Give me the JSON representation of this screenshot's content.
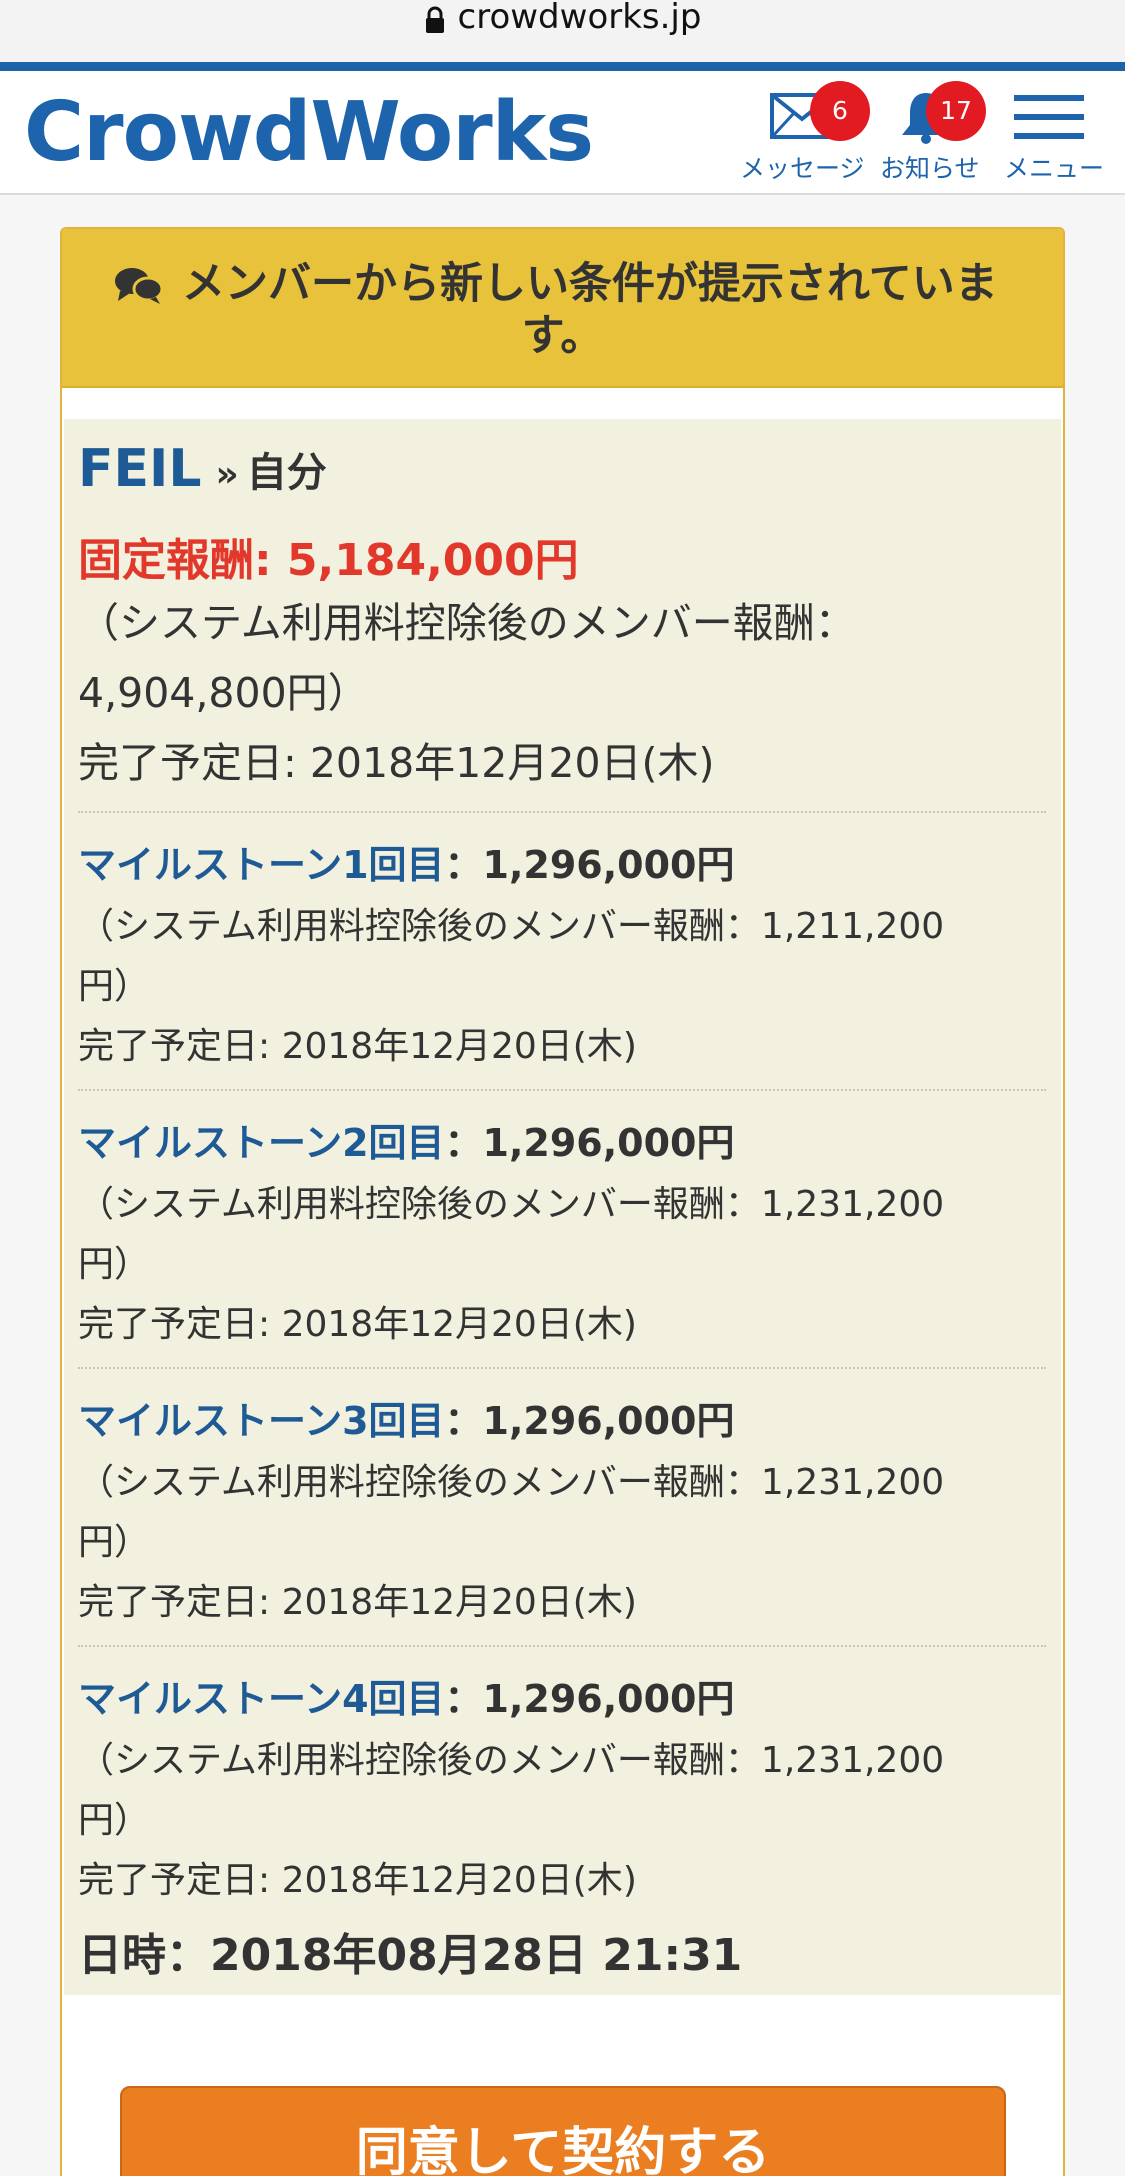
{
  "browser": {
    "url": "crowdworks.jp"
  },
  "header": {
    "logo": "CrowdWorks",
    "messages": {
      "label": "メッセージ",
      "count": "6"
    },
    "notifications": {
      "label": "お知らせ",
      "count": "17"
    },
    "menu": {
      "label": "メニュー"
    }
  },
  "alert": {
    "line1": "メンバーから新しい条件が提示されていま",
    "line2": "す。"
  },
  "offer": {
    "client": "FEIL",
    "separator": "»",
    "recipient": "自分",
    "fixed_reward": "固定報酬: 5,184,000円",
    "net_line1": "（システム利用料控除後のメンバー報酬：",
    "net_line2": "4,904,800円）",
    "due": "完了予定日: 2018年12月20日(木)"
  },
  "milestones": [
    {
      "title": "マイルストーン1回目",
      "amount": "：1,296,000円",
      "net_line1": "（システム利用料控除後のメンバー報酬：1,211,200",
      "net_line2": "円）",
      "due": "完了予定日: 2018年12月20日(木)"
    },
    {
      "title": "マイルストーン2回目",
      "amount": "：1,296,000円",
      "net_line1": "（システム利用料控除後のメンバー報酬：1,231,200",
      "net_line2": "円）",
      "due": "完了予定日: 2018年12月20日(木)"
    },
    {
      "title": "マイルストーン3回目",
      "amount": "：1,296,000円",
      "net_line1": "（システム利用料控除後のメンバー報酬：1,231,200",
      "net_line2": "円）",
      "due": "完了予定日: 2018年12月20日(木)"
    },
    {
      "title": "マイルストーン4回目",
      "amount": "：1,296,000円",
      "net_line1": "（システム利用料控除後のメンバー報酬：1,231,200",
      "net_line2": "円）",
      "due": "完了予定日: 2018年12月20日(木)"
    }
  ],
  "datetime": "日時：2018年08月28日 21:31",
  "agree_button": "同意して契約する",
  "colors": {
    "brand_blue": "#1d64ad",
    "alert_yellow": "#e8c23a",
    "reward_red": "#e2382b",
    "button_orange": "#ea7e20",
    "badge_red": "#e21b23"
  }
}
